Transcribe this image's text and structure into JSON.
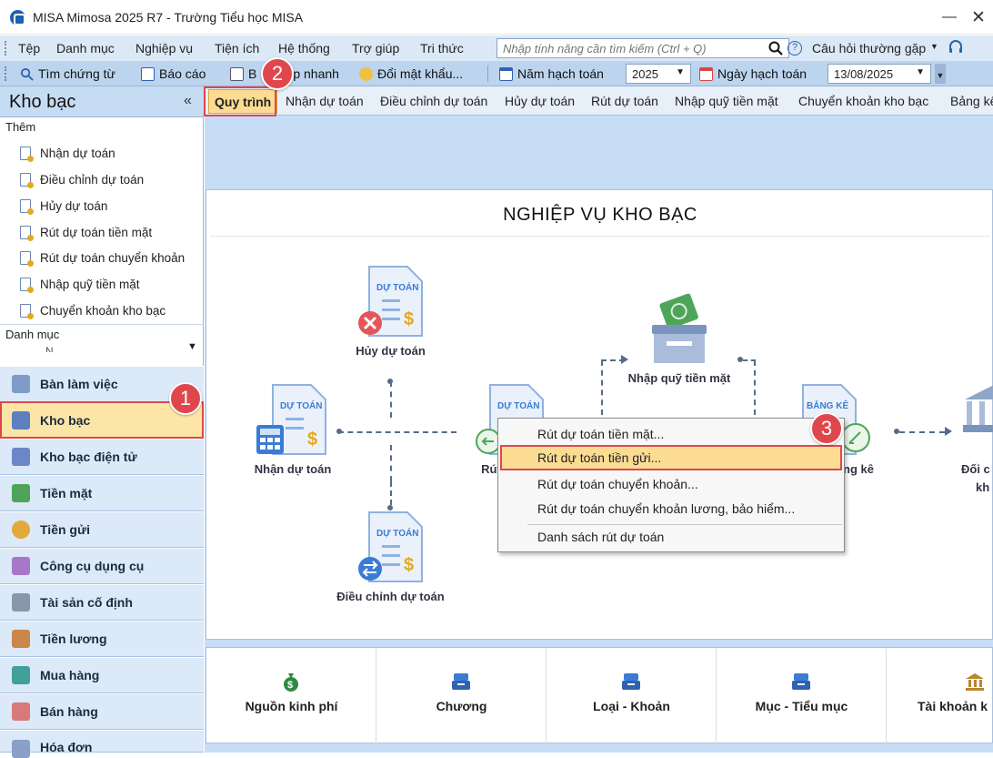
{
  "window": {
    "title": "MISA Mimosa 2025 R7 - Trường Tiểu học MISA",
    "minimize": "—",
    "close": "✕"
  },
  "menubar": {
    "items": [
      "Tệp",
      "Danh mục",
      "Nghiệp vụ",
      "Tiện ích",
      "Hệ thống",
      "Trợ giúp",
      "Tri thức"
    ],
    "search_placeholder": "Nhập tính năng cần tìm kiếm (Ctrl + Q)",
    "help_icon": "?",
    "faq": "Câu hỏi thường gặp"
  },
  "toolbar": {
    "items": [
      "Tìm chứng từ",
      "Báo cáo",
      "Báo cáo nhanh",
      "Đổi mật khẩu..."
    ],
    "items_visible": [
      "Tìm chứng từ",
      "Báo cáo",
      "B",
      "p nhanh",
      "Đổi mật khẩu..."
    ],
    "fiscal_year_label": "Năm hạch toán",
    "fiscal_year_value": "2025",
    "posting_date_label": "Ngày hạch toán",
    "posting_date_value": "13/08/2025"
  },
  "sidebar": {
    "title": "Kho bạc",
    "collapse": "«",
    "add_label": "Thêm",
    "links": [
      "Nhận dự toán",
      "Điều chỉnh dự toán",
      "Hủy dự toán",
      "Rút dự toán tiền mặt",
      "Rút dự toán chuyển khoản",
      "Nhập quỹ tiền mặt",
      "Chuyển khoản kho bạc"
    ],
    "category_label": "Danh mục",
    "category_partial": "N      ,,,,,,,,,,",
    "nav": [
      "Bàn làm việc",
      "Kho bạc",
      "Kho bạc điện tử",
      "Tiền mặt",
      "Tiền gửi",
      "Công cụ dụng cụ",
      "Tài sản cố định",
      "Tiền lương",
      "Mua hàng",
      "Bán hàng",
      "Hóa đơn"
    ],
    "active_nav": "Kho bạc"
  },
  "tabs": [
    "Quy trình",
    "Nhận dự toán",
    "Điều chỉnh dự toán",
    "Hủy dự toán",
    "Rút dự toán",
    "Nhập quỹ tiền mặt",
    "Chuyển khoản kho bạc",
    "Bảng kê"
  ],
  "active_tab": "Quy trình",
  "process": {
    "title": "NGHIỆP VỤ KHO BẠC",
    "nodes": {
      "huy": {
        "label": "Hủy dự toán",
        "doc": "DỰ TOÁN"
      },
      "nhan": {
        "label": "Nhận dự toán",
        "doc": "DỰ TOÁN"
      },
      "dieu_chinh": {
        "label": "Điều chỉnh dự toán",
        "doc": "DỰ TOÁN"
      },
      "rut": {
        "label": "Rút",
        "doc": "DỰ TOÁN"
      },
      "nhap_quy": {
        "label": "Nhập quỹ tiền mặt"
      },
      "bang_ke": {
        "label": "ng kê",
        "doc": "BẢNG KÊ"
      },
      "doi_chieu": {
        "label1": "Đối c",
        "label2": "kh"
      }
    }
  },
  "context_menu": {
    "items": [
      "Rút dự toán tiền mặt...",
      "Rút dự toán tiền gửi...",
      "Rút dự toán chuyển khoản...",
      "Rút dự toán chuyển khoản lương, bảo hiểm...",
      "Danh sách rút dự toán"
    ],
    "highlighted": "Rút dự toán tiền gửi..."
  },
  "categories": [
    "Nguồn kinh phí",
    "Chương",
    "Loại - Khoản",
    "Mục - Tiểu mục",
    "Tài khoản k"
  ],
  "badges": [
    "1",
    "2",
    "3"
  ],
  "colors": {
    "accent": "#e0474c",
    "highlight": "#fbdc92",
    "panel_bg": "#c7ddf6",
    "toolbar_bg": "#bcd4ee"
  }
}
